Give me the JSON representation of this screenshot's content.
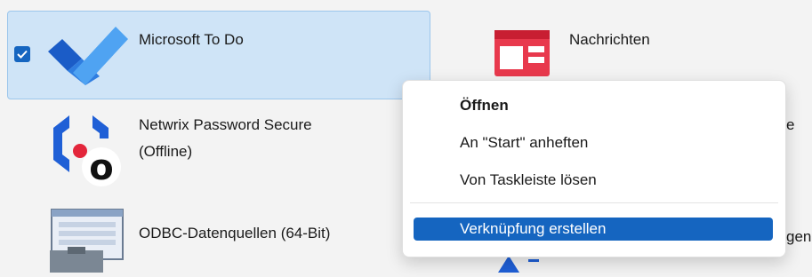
{
  "apps": {
    "todo": {
      "label": "Microsoft To Do",
      "icon": "todo-check-icon",
      "selected": true
    },
    "nachrichten": {
      "label": "Nachrichten",
      "icon": "news-icon"
    },
    "netwrix": {
      "label_line1": "Netwrix Password Secure",
      "label_line2": "(Offline)",
      "icon": "netwrix-icon"
    },
    "odbc": {
      "label": "ODBC-Datenquellen (64-Bit)",
      "icon": "odbc-icon"
    },
    "right_partial_top": {
      "label": "e"
    },
    "right_partial_bottom": {
      "label": "gen"
    }
  },
  "context_menu": {
    "items": [
      {
        "label": "Öffnen",
        "bold": true
      },
      {
        "label": "An \"Start\" anheften"
      },
      {
        "label": "Von Taskleiste lösen"
      },
      {
        "label": "Verknüpfung erstellen",
        "highlighted": true
      }
    ]
  },
  "colors": {
    "selection_bg": "#cfe4f7",
    "accent": "#1565c0",
    "news_red": "#e8394d"
  }
}
